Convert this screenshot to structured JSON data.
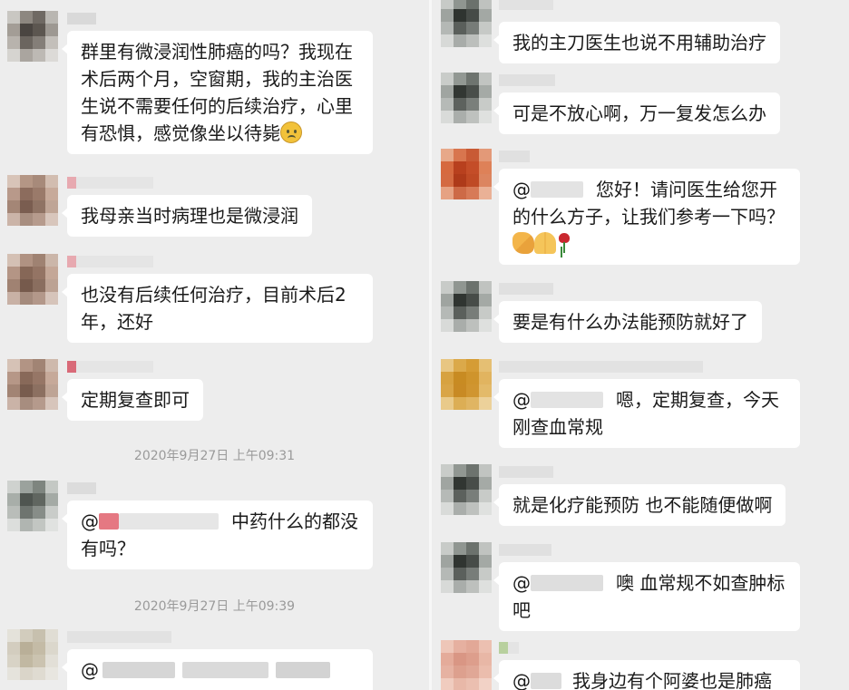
{
  "left": {
    "messages": [
      {
        "id": "l1",
        "pre": "群里有微浸润性肺癌的吗？我现在术后两个月，空窗期，我的主治医生说不需要任何的后续治疗，心里有恐惧，感觉像坐以待毙",
        "emoji": "sad-face-emoji"
      },
      {
        "id": "l2",
        "text": "我母亲当时病理也是微浸润"
      },
      {
        "id": "l3",
        "text": "也没有后续任何治疗，目前术后2年，还好"
      },
      {
        "id": "l4",
        "text": "定期复查即可"
      },
      {
        "id": "l5",
        "at": "@",
        "post": "中药什么的都没有吗？"
      },
      {
        "id": "l6",
        "at": "@"
      }
    ],
    "timestamps": [
      "2020年9月27日 上午09:31",
      "2020年9月27日 上午09:39"
    ]
  },
  "right": {
    "messages": [
      {
        "id": "r1",
        "text": "我的主刀医生也说不用辅助治疗"
      },
      {
        "id": "r2",
        "text": "可是不放心啊，万一复发怎么办"
      },
      {
        "id": "r3",
        "at": "@",
        "post": "您好！请问医生给您开的什么方子，让我们参考一下吗？",
        "emojis": [
          "handshake-emoji",
          "pray-emoji",
          "rose-emoji"
        ]
      },
      {
        "id": "r4",
        "text": "要是有什么办法能预防就好了"
      },
      {
        "id": "r5",
        "at": "@",
        "post": "嗯，定期复查，今天刚查血常规"
      },
      {
        "id": "r6",
        "text": "就是化疗能预防 也不能随便做啊"
      },
      {
        "id": "r7",
        "at": "@",
        "post": "噢 血常规不如查肿标吧"
      },
      {
        "id": "r8",
        "at": "@",
        "post": "我身边有个阿婆也是肺癌"
      }
    ]
  },
  "colors": {
    "background": "#ededed",
    "bubble": "#ffffff",
    "text": "#1a1a1a",
    "timestamp": "#9a9a9a",
    "divider": "#f7f7f7"
  }
}
